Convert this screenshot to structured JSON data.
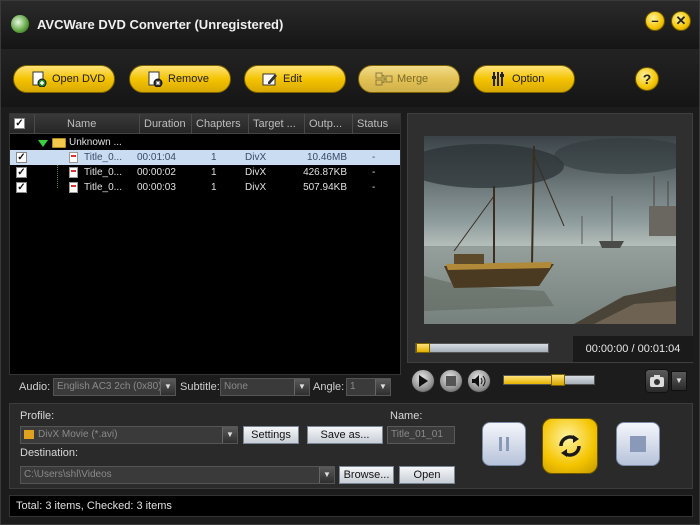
{
  "window": {
    "title": "AVCWare DVD Converter (Unregistered)",
    "minimize": "–",
    "close": "✕"
  },
  "toolbar": {
    "open_dvd": "Open DVD",
    "remove": "Remove",
    "edit": "Edit",
    "merge": "Merge",
    "option": "Option",
    "help": "?"
  },
  "list": {
    "columns": [
      "Name",
      "Duration",
      "Chapters",
      "Target ...",
      "Outp...",
      "Status"
    ],
    "folder": {
      "name": "Unknown ..."
    },
    "rows": [
      {
        "name": "Title_0...",
        "duration": "00:01:04",
        "chapters": "1",
        "target": "DivX",
        "output": "10.46MB",
        "status": "-",
        "selected": true
      },
      {
        "name": "Title_0...",
        "duration": "00:00:02",
        "chapters": "1",
        "target": "DivX",
        "output": "426.87KB",
        "status": "-",
        "selected": false
      },
      {
        "name": "Title_0...",
        "duration": "00:00:03",
        "chapters": "1",
        "target": "DivX",
        "output": "507.94KB",
        "status": "-",
        "selected": false
      }
    ]
  },
  "player": {
    "time": "00:00:00 / 00:01:04",
    "progress": 0.0,
    "volume": 0.6
  },
  "options": {
    "audio_label": "Audio:",
    "audio_value": "English AC3 2ch (0x80)",
    "subtitle_label": "Subtitle:",
    "subtitle_value": "None",
    "angle_label": "Angle:",
    "angle_value": "1"
  },
  "output": {
    "profile_label": "Profile:",
    "profile_value": "DivX Movie (*.avi)",
    "settings": "Settings",
    "save_as": "Save as...",
    "name_label": "Name:",
    "name_value": "Title_01_01",
    "destination_label": "Destination:",
    "destination_value": "C:\\Users\\shl\\Videos",
    "browse": "Browse...",
    "open": "Open"
  },
  "status": {
    "text": "Total: 3 items, Checked: 3 items"
  },
  "colors": {
    "accent": "#f4c400",
    "background": "#1c1c1c",
    "selection": "#c9dcf2"
  }
}
